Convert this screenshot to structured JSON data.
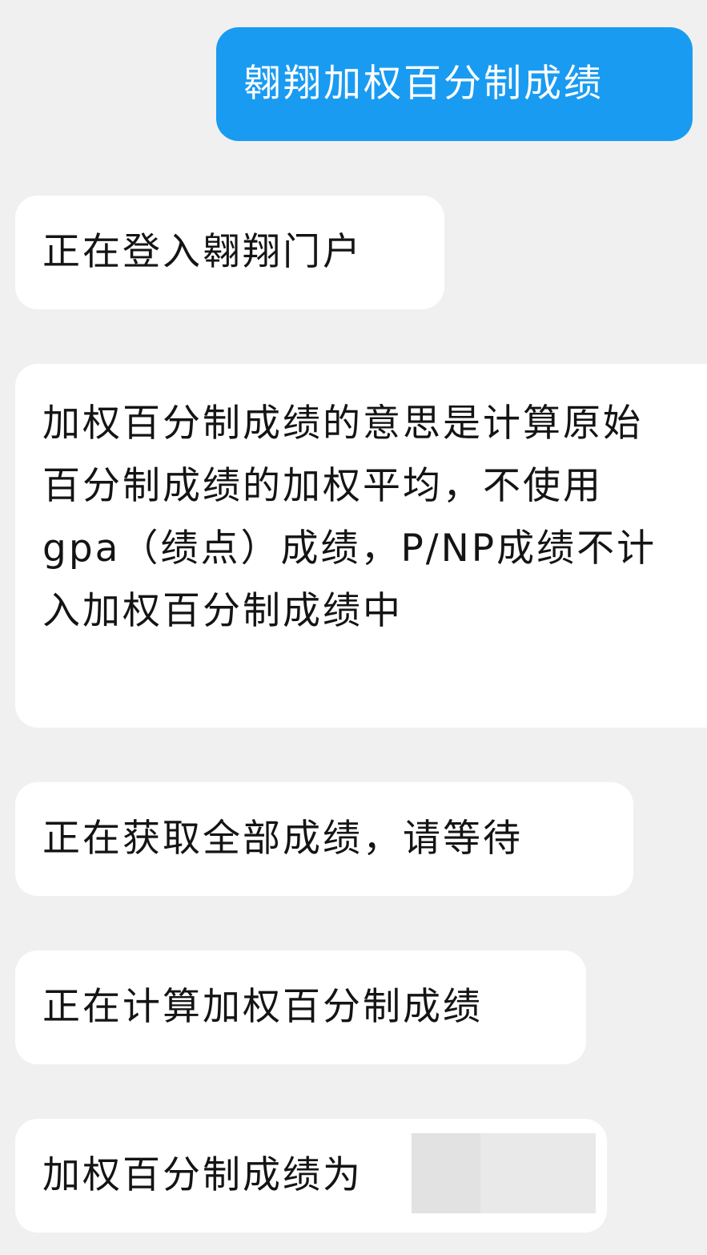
{
  "messages": {
    "user_query": "翱翔加权百分制成绩",
    "login_status": "正在登入翱翔门户",
    "explanation": "加权百分制成绩的意思是计算原始百分制成绩的加权平均，不使用gpa（绩点）成绩，P/NP成绩不计入加权百分制成绩中",
    "fetch_status": "正在获取全部成绩，请等待",
    "calc_status": "正在计算加权百分制成绩",
    "result_label": "加权百分制成绩为"
  },
  "colors": {
    "background": "#f0f0f0",
    "user_bubble": "#1a9bf2",
    "bot_bubble": "#ffffff",
    "redaction": "#e2e2e2"
  }
}
